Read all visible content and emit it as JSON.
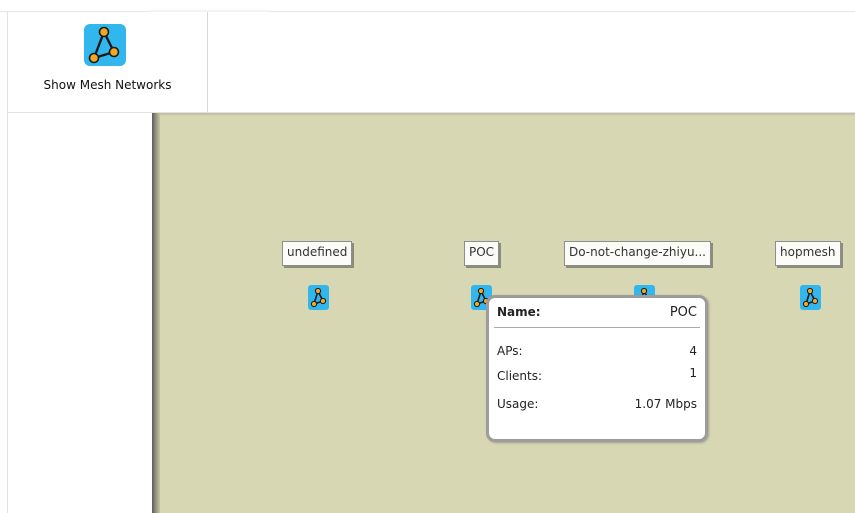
{
  "toolbar": {
    "show_mesh_label": "Show Mesh Networks",
    "show_mesh_icon": "mesh-network-icon"
  },
  "networks": [
    {
      "label": "undefined",
      "icon": "mesh-network-icon"
    },
    {
      "label": "POC",
      "icon": "mesh-network-icon"
    },
    {
      "label": "Do-not-change-zhiyu...",
      "icon": "mesh-network-icon"
    },
    {
      "label": "hopmesh",
      "icon": "mesh-network-icon"
    }
  ],
  "tooltip": {
    "name_label": "Name:",
    "name_value": "POC",
    "aps_label": "APs:",
    "aps_value": "4",
    "clients_label": "Clients:",
    "clients_value": "1",
    "usage_label": "Usage:",
    "usage_value": "1.07 Mbps"
  },
  "colors": {
    "canvas_bg": "#d7d7b4",
    "icon_bg": "#32b6ee",
    "node_fill": "#f5a623",
    "edge": "#1a1a1a"
  }
}
